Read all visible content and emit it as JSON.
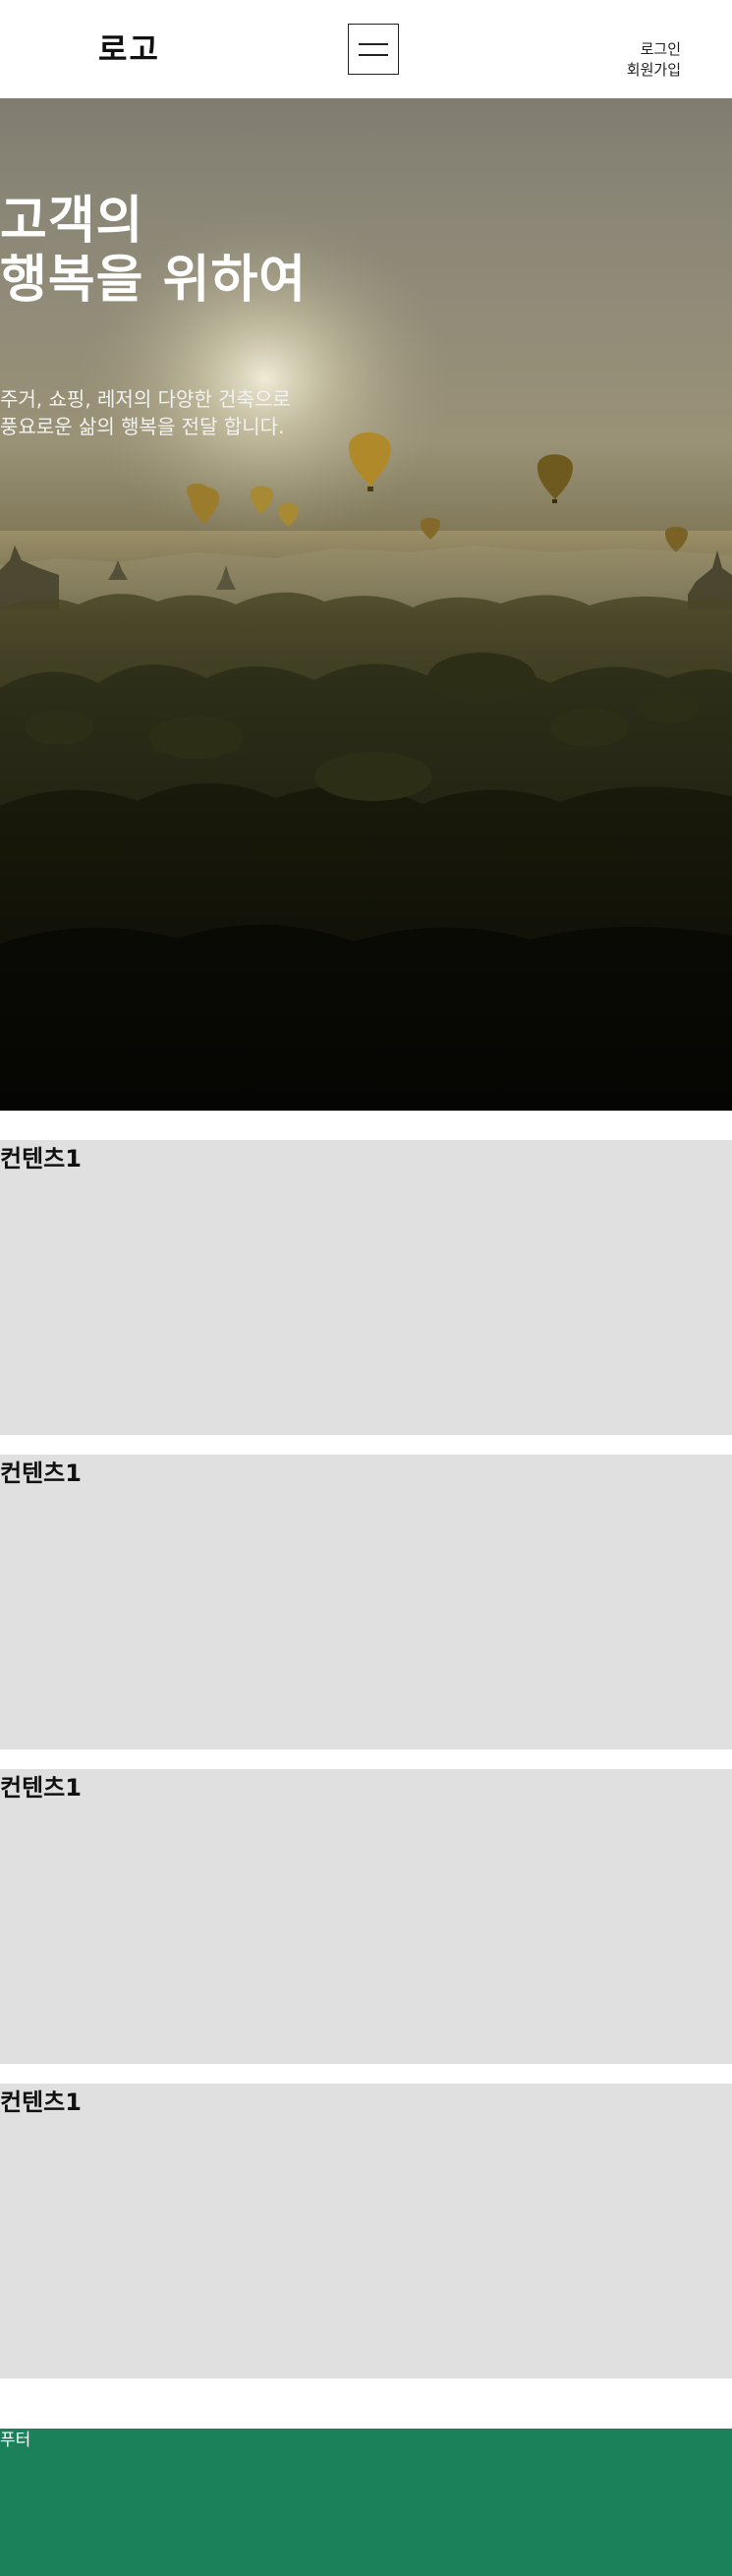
{
  "header": {
    "logo": "로고",
    "login": "로그인",
    "signup": "회원가입"
  },
  "hero": {
    "title_line1": "고객의",
    "title_line2": "행복을 위하여",
    "subtitle_line1": "주거, 쇼핑, 레저의 다양한 건축으로",
    "subtitle_line2": "풍요로운 삶의 행복을 전달 합니다."
  },
  "sections": [
    {
      "title": "컨텐츠1"
    },
    {
      "title": "컨텐츠1"
    },
    {
      "title": "컨텐츠1"
    },
    {
      "title": "컨텐츠1"
    }
  ],
  "footer": {
    "text": "푸터",
    "color": "#1b815b"
  },
  "colors": {
    "content_bg": "#e0e0e0",
    "page_bg": "#ffffff"
  }
}
